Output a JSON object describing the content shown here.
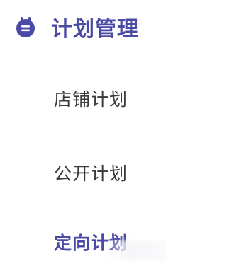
{
  "menu": {
    "header": {
      "title": "计划管理",
      "icon": "calendar-icon",
      "accent_color": "#4b4aa6"
    },
    "items": [
      {
        "label": "店铺计划"
      },
      {
        "label": "公开计划"
      },
      {
        "label": "定向计划"
      }
    ]
  }
}
